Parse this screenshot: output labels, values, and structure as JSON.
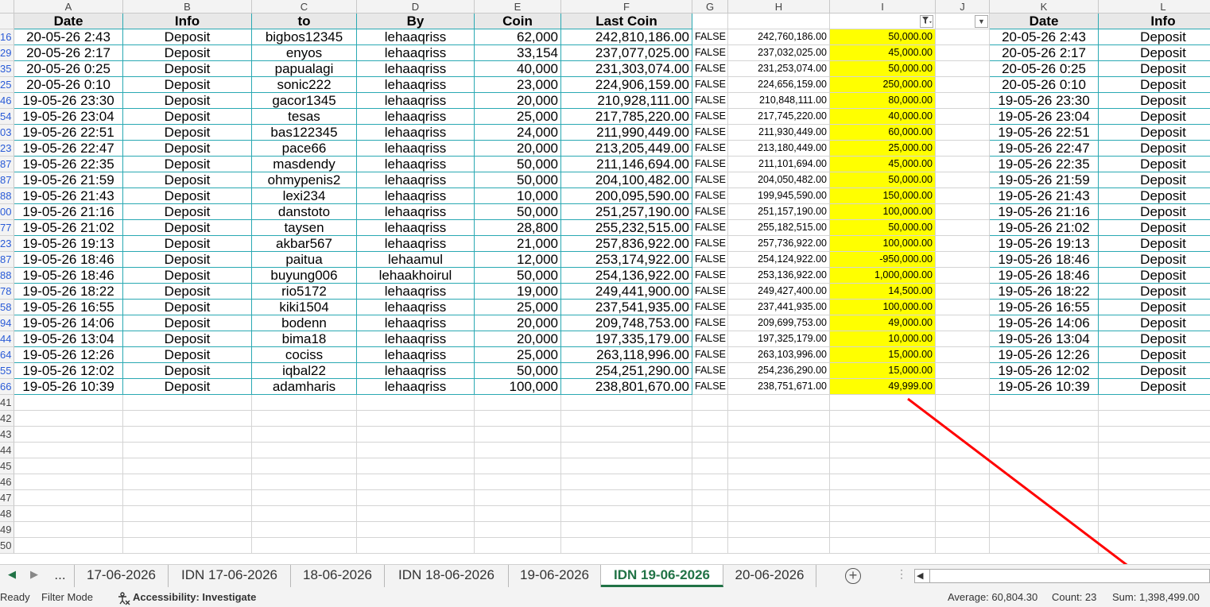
{
  "col_letters": [
    "A",
    "B",
    "C",
    "D",
    "E",
    "F",
    "G",
    "H",
    "I",
    "J",
    "K",
    "L"
  ],
  "header_row": {
    "date": "Date",
    "info": "Info",
    "to": "to",
    "by": "By",
    "coin": "Coin",
    "last_coin": "Last Coin",
    "k_date": "Date",
    "l_info": "Info"
  },
  "filter_icons": {
    "filtered": "filter-funnel-icon",
    "dropdown": "dropdown-arrow-icon"
  },
  "rows": [
    {
      "rn": "16",
      "date": "20-05-26 2:43",
      "info": "Deposit",
      "to": "bigbos12345",
      "by": "lehaaqriss",
      "coin": "62,000",
      "last": "242,810,186.00",
      "g": "FALSE",
      "h": "242,760,186.00",
      "i": "50,000.00"
    },
    {
      "rn": "29",
      "date": "20-05-26 2:17",
      "info": "Deposit",
      "to": "enyos",
      "by": "lehaaqriss",
      "coin": "33,154",
      "last": "237,077,025.00",
      "g": "FALSE",
      "h": "237,032,025.00",
      "i": "45,000.00"
    },
    {
      "rn": "35",
      "date": "20-05-26 0:25",
      "info": "Deposit",
      "to": "papualagi",
      "by": "lehaaqriss",
      "coin": "40,000",
      "last": "231,303,074.00",
      "g": "FALSE",
      "h": "231,253,074.00",
      "i": "50,000.00"
    },
    {
      "rn": "25",
      "date": "20-05-26 0:10",
      "info": "Deposit",
      "to": "sonic222",
      "by": "lehaaqriss",
      "coin": "23,000",
      "last": "224,906,159.00",
      "g": "FALSE",
      "h": "224,656,159.00",
      "i": "250,000.00"
    },
    {
      "rn": "46",
      "date": "19-05-26 23:30",
      "info": "Deposit",
      "to": "gacor1345",
      "by": "lehaaqriss",
      "coin": "20,000",
      "last": "210,928,111.00",
      "g": "FALSE",
      "h": "210,848,111.00",
      "i": "80,000.00"
    },
    {
      "rn": "54",
      "date": "19-05-26 23:04",
      "info": "Deposit",
      "to": "tesas",
      "by": "lehaaqriss",
      "coin": "25,000",
      "last": "217,785,220.00",
      "g": "FALSE",
      "h": "217,745,220.00",
      "i": "40,000.00"
    },
    {
      "rn": "03",
      "date": "19-05-26 22:51",
      "info": "Deposit",
      "to": "bas122345",
      "by": "lehaaqriss",
      "coin": "24,000",
      "last": "211,990,449.00",
      "g": "FALSE",
      "h": "211,930,449.00",
      "i": "60,000.00"
    },
    {
      "rn": "23",
      "date": "19-05-26 22:47",
      "info": "Deposit",
      "to": "pace66",
      "by": "lehaaqriss",
      "coin": "20,000",
      "last": "213,205,449.00",
      "g": "FALSE",
      "h": "213,180,449.00",
      "i": "25,000.00"
    },
    {
      "rn": "87",
      "date": "19-05-26 22:35",
      "info": "Deposit",
      "to": "masdendy",
      "by": "lehaaqriss",
      "coin": "50,000",
      "last": "211,146,694.00",
      "g": "FALSE",
      "h": "211,101,694.00",
      "i": "45,000.00"
    },
    {
      "rn": "87",
      "date": "19-05-26 21:59",
      "info": "Deposit",
      "to": "ohmypenis2",
      "by": "lehaaqriss",
      "coin": "50,000",
      "last": "204,100,482.00",
      "g": "FALSE",
      "h": "204,050,482.00",
      "i": "50,000.00"
    },
    {
      "rn": "88",
      "date": "19-05-26 21:43",
      "info": "Deposit",
      "to": "lexi234",
      "by": "lehaaqriss",
      "coin": "10,000",
      "last": "200,095,590.00",
      "g": "FALSE",
      "h": "199,945,590.00",
      "i": "150,000.00"
    },
    {
      "rn": "00",
      "date": "19-05-26 21:16",
      "info": "Deposit",
      "to": "danstoto",
      "by": "lehaaqriss",
      "coin": "50,000",
      "last": "251,257,190.00",
      "g": "FALSE",
      "h": "251,157,190.00",
      "i": "100,000.00"
    },
    {
      "rn": "77",
      "date": "19-05-26 21:02",
      "info": "Deposit",
      "to": "taysen",
      "by": "lehaaqriss",
      "coin": "28,800",
      "last": "255,232,515.00",
      "g": "FALSE",
      "h": "255,182,515.00",
      "i": "50,000.00"
    },
    {
      "rn": "23",
      "date": "19-05-26 19:13",
      "info": "Deposit",
      "to": "akbar567",
      "by": "lehaaqriss",
      "coin": "21,000",
      "last": "257,836,922.00",
      "g": "FALSE",
      "h": "257,736,922.00",
      "i": "100,000.00"
    },
    {
      "rn": "87",
      "date": "19-05-26 18:46",
      "info": "Deposit",
      "to": "paitua",
      "by": "lehaamul",
      "coin": "12,000",
      "last": "253,174,922.00",
      "g": "FALSE",
      "h": "254,124,922.00",
      "i": "-950,000.00"
    },
    {
      "rn": "88",
      "date": "19-05-26 18:46",
      "info": "Deposit",
      "to": "buyung006",
      "by": "lehaakhoirul",
      "coin": "50,000",
      "last": "254,136,922.00",
      "g": "FALSE",
      "h": "253,136,922.00",
      "i": "1,000,000.00"
    },
    {
      "rn": "78",
      "date": "19-05-26 18:22",
      "info": "Deposit",
      "to": "rio5172",
      "by": "lehaaqriss",
      "coin": "19,000",
      "last": "249,441,900.00",
      "g": "FALSE",
      "h": "249,427,400.00",
      "i": "14,500.00"
    },
    {
      "rn": "58",
      "date": "19-05-26 16:55",
      "info": "Deposit",
      "to": "kiki1504",
      "by": "lehaaqriss",
      "coin": "25,000",
      "last": "237,541,935.00",
      "g": "FALSE",
      "h": "237,441,935.00",
      "i": "100,000.00"
    },
    {
      "rn": "94",
      "date": "19-05-26 14:06",
      "info": "Deposit",
      "to": "bodenn",
      "by": "lehaaqriss",
      "coin": "20,000",
      "last": "209,748,753.00",
      "g": "FALSE",
      "h": "209,699,753.00",
      "i": "49,000.00"
    },
    {
      "rn": "44",
      "date": "19-05-26 13:04",
      "info": "Deposit",
      "to": "bima18",
      "by": "lehaaqriss",
      "coin": "20,000",
      "last": "197,335,179.00",
      "g": "FALSE",
      "h": "197,325,179.00",
      "i": "10,000.00"
    },
    {
      "rn": "64",
      "date": "19-05-26 12:26",
      "info": "Deposit",
      "to": "cociss",
      "by": "lehaaqriss",
      "coin": "25,000",
      "last": "263,118,996.00",
      "g": "FALSE",
      "h": "263,103,996.00",
      "i": "15,000.00"
    },
    {
      "rn": "55",
      "date": "19-05-26 12:02",
      "info": "Deposit",
      "to": "iqbal22",
      "by": "lehaaqriss",
      "coin": "50,000",
      "last": "254,251,290.00",
      "g": "FALSE",
      "h": "254,236,290.00",
      "i": "15,000.00"
    },
    {
      "rn": "66",
      "date": "19-05-26 10:39",
      "info": "Deposit",
      "to": "adamharis",
      "by": "lehaaqriss",
      "coin": "100,000",
      "last": "238,801,670.00",
      "g": "FALSE",
      "h": "238,751,671.00",
      "i": "49,999.00"
    }
  ],
  "empty_rows": [
    "41",
    "42",
    "43",
    "44",
    "45",
    "46",
    "47",
    "48",
    "49",
    "50"
  ],
  "tabs": {
    "more": "...",
    "items": [
      {
        "label": "17-06-2026",
        "active": false
      },
      {
        "label": "IDN 17-06-2026",
        "active": false
      },
      {
        "label": "18-06-2026",
        "active": false
      },
      {
        "label": "IDN 18-06-2026",
        "active": false
      },
      {
        "label": "19-06-2026",
        "active": false
      },
      {
        "label": "IDN 19-06-2026",
        "active": true
      },
      {
        "label": "20-06-2026",
        "active": false
      }
    ]
  },
  "status": {
    "ready": "Ready",
    "filter_mode": "Filter Mode",
    "accessibility": "Accessibility: Investigate",
    "average": "Average: 60,804.30",
    "count": "Count: 23",
    "sum": "Sum: 1,398,499.00"
  },
  "colors": {
    "highlight": "#ffff00",
    "arrow": "#ff0000",
    "active_tab": "#217346",
    "table_border": "#2aa9b3"
  }
}
